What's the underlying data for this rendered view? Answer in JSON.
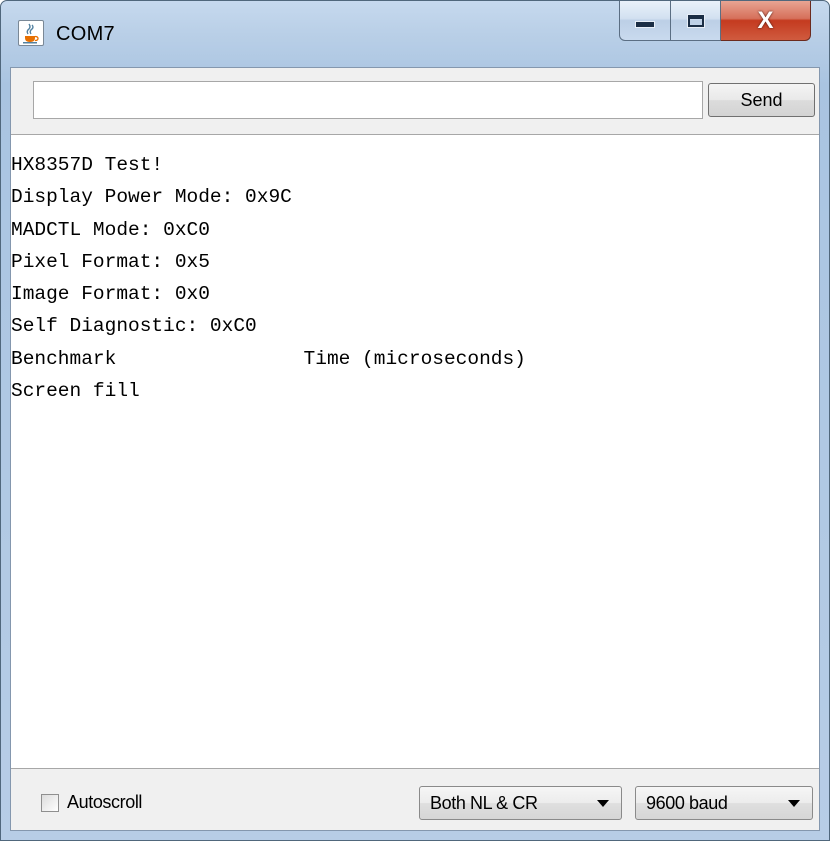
{
  "window": {
    "title": "COM7",
    "icon": "java-cup-icon",
    "minimize_glyph": "minimize-icon",
    "maximize_glyph": "maximize-icon",
    "close_symbol": "X"
  },
  "input_row": {
    "input_value": "",
    "send_label": "Send"
  },
  "serial_output": {
    "lines": [
      "HX8357D Test!",
      "Display Power Mode: 0x9C",
      "MADCTL Mode: 0xC0",
      "Pixel Format: 0x5",
      "Image Format: 0x0",
      "Self Diagnostic: 0xC0",
      "Benchmark                Time (microseconds)",
      "Screen fill"
    ]
  },
  "status_row": {
    "autoscroll_label": "Autoscroll",
    "autoscroll_checked": false,
    "line_ending": "Both NL & CR",
    "baud_rate": "9600 baud"
  },
  "colors": {
    "frame": "#a9c4e1",
    "close_button": "#c43a1f",
    "client_bg": "#f0f0f0",
    "output_bg": "#ffffff"
  }
}
